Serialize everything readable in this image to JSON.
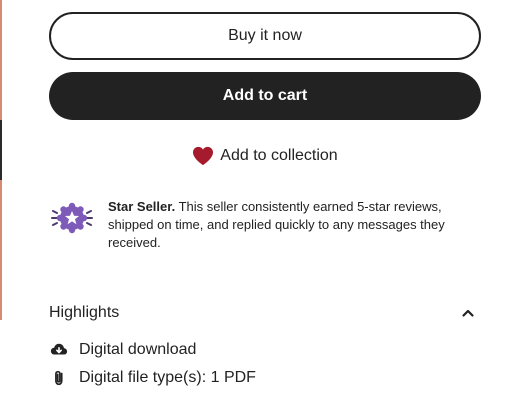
{
  "buttons": {
    "buy_now": "Buy it now",
    "add_to_cart": "Add to cart"
  },
  "collection": {
    "label": "Add to collection"
  },
  "star_seller": {
    "title": "Star Seller.",
    "description": " This seller consistently earned 5-star reviews, shipped on time, and replied quickly to any messages they received."
  },
  "highlights": {
    "title": "Highlights",
    "items": [
      {
        "icon": "cloud-download-icon",
        "label": "Digital download"
      },
      {
        "icon": "paperclip-icon",
        "label": "Digital file type(s): 1 PDF"
      }
    ]
  },
  "colors": {
    "primary_dark": "#222222",
    "heart": "#a61a2e",
    "badge_purple": "#7e5bb8"
  }
}
